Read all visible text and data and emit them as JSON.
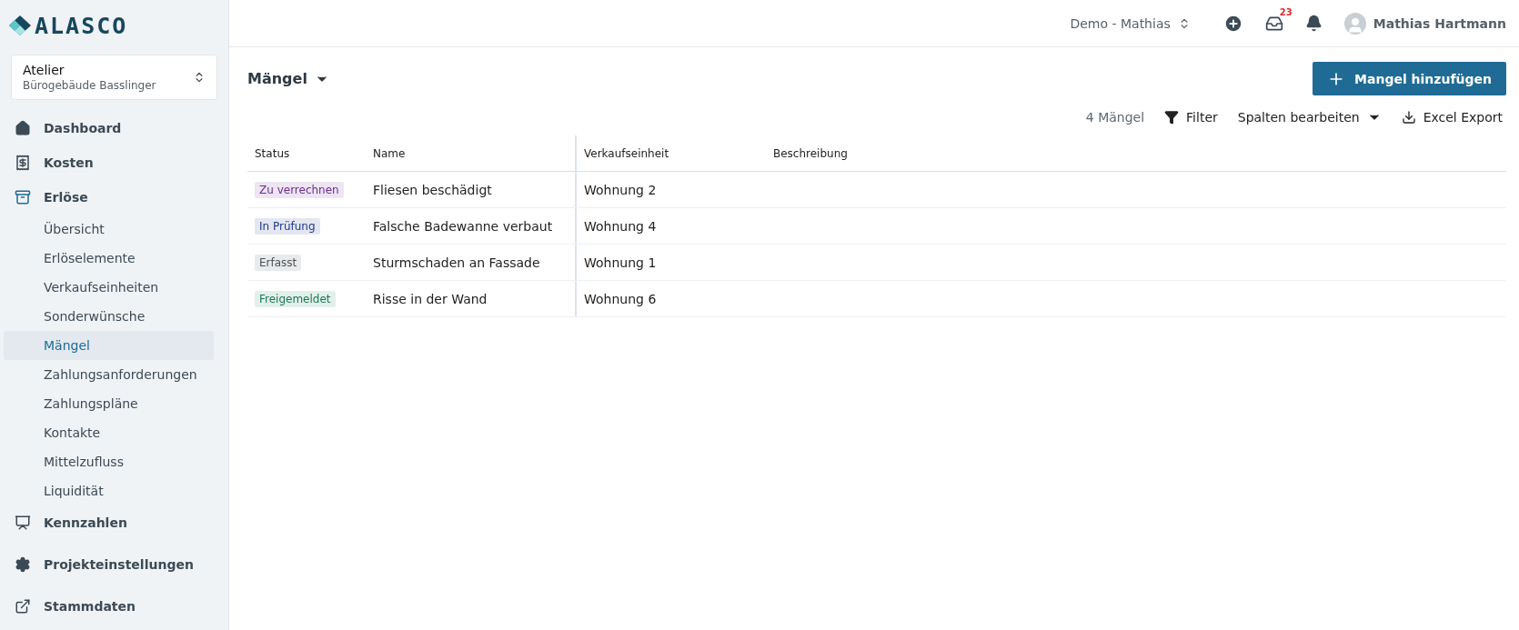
{
  "logo": {
    "text": "ALASCO"
  },
  "project": {
    "name": "Atelier",
    "subtitle": "Bürogebäude Basslinger"
  },
  "sidebar": {
    "items": [
      {
        "label": "Dashboard",
        "selected": false
      },
      {
        "label": "Kosten",
        "selected": false
      },
      {
        "label": "Erlöse",
        "selected": false,
        "children": [
          {
            "label": "Übersicht",
            "selected": false
          },
          {
            "label": "Erlöselemente",
            "selected": false
          },
          {
            "label": "Verkaufseinheiten",
            "selected": false
          },
          {
            "label": "Sonderwünsche",
            "selected": false
          },
          {
            "label": "Mängel",
            "selected": true
          },
          {
            "label": "Zahlungsanforderungen",
            "selected": false
          },
          {
            "label": "Zahlungspläne",
            "selected": false
          },
          {
            "label": "Kontakte",
            "selected": false
          },
          {
            "label": "Mittelzufluss",
            "selected": false
          },
          {
            "label": "Liquidität",
            "selected": false
          }
        ]
      },
      {
        "label": "Kennzahlen",
        "selected": false
      },
      {
        "label": "Projekteinstellungen",
        "selected": false
      },
      {
        "label": "Stammdaten",
        "selected": false
      }
    ]
  },
  "topbar": {
    "workspace": "Demo - Mathias",
    "inbox_count": "23",
    "user": "Mathias Hartmann"
  },
  "page": {
    "title": "Mängel",
    "add_button": "Mangel hinzufügen"
  },
  "toolbar": {
    "count": "4 Mängel",
    "filter": "Filter",
    "columns": "Spalten bearbeiten",
    "export": "Excel Export"
  },
  "table": {
    "columns": [
      "Status",
      "Name",
      "Verkaufseinheit",
      "Beschreibung"
    ],
    "rows": [
      {
        "status": {
          "label": "Zu verrechnen",
          "color": "#6b2c91"
        },
        "name": "Fliesen beschädigt",
        "unit": "Wohnung 2"
      },
      {
        "status": {
          "label": "In Prüfung",
          "color": "#1e3a8a"
        },
        "name": "Falsche Badewanne verbaut",
        "unit": "Wohnung 4"
      },
      {
        "status": {
          "label": "Erfasst",
          "color": "#4b5258"
        },
        "name": "Sturmschaden an Fassade",
        "unit": "Wohnung 1"
      },
      {
        "status": {
          "label": "Freigemeldet",
          "color": "#1a7a55"
        },
        "name": "Risse in der Wand",
        "unit": "Wohnung 6"
      }
    ]
  }
}
